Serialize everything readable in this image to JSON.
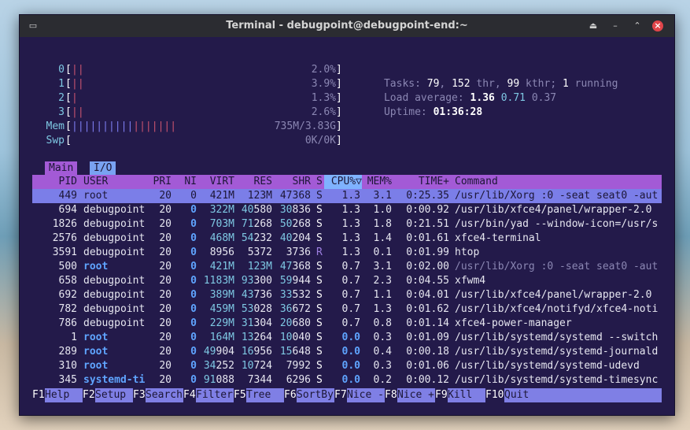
{
  "window": {
    "title": "Terminal - debugpoint@debugpoint-end:~"
  },
  "meters": {
    "cpu": [
      {
        "label": "0",
        "bars": "||",
        "percent": "2.0%"
      },
      {
        "label": "1",
        "bars": "||",
        "percent": "3.9%"
      },
      {
        "label": "2",
        "bars": "|",
        "percent": "1.3%"
      },
      {
        "label": "3",
        "bars": "||",
        "percent": "2.6%"
      }
    ],
    "mem": {
      "label": "Mem",
      "bars": "|||||||||||||||||",
      "value": "735M/3.83G"
    },
    "swp": {
      "label": "Swp",
      "value": "0K/0K"
    },
    "tasks_label": "Tasks:",
    "tasks": "79",
    "thr": "152",
    "thr_label": "thr,",
    "kthr": "99",
    "kthr_label": "kthr;",
    "running": "1",
    "running_label": "running",
    "load_label": "Load average:",
    "load1": "1.36",
    "load5": "0.71",
    "load15": "0.37",
    "uptime_label": "Uptime:",
    "uptime": "01:36:28"
  },
  "tabs": [
    "Main",
    "I/O"
  ],
  "columns": [
    "PID",
    "USER",
    "PRI",
    "NI",
    "VIRT",
    "RES",
    "SHR",
    "S",
    "CPU%▽",
    "MEM%",
    "TIME+",
    "Command"
  ],
  "rows": [
    {
      "pid": "449",
      "user": "root",
      "pri": "20",
      "ni": "0",
      "virt": "421M",
      "res": "123M",
      "shr": "47368",
      "s": "S",
      "cpu": "1.3",
      "mem": "3.1",
      "time": "0:25.35",
      "cmd": "/usr/lib/Xorg :0 -seat seat0 -aut"
    },
    {
      "pid": "694",
      "user": "debugpoint",
      "pri": "20",
      "ni": "0",
      "virt": "322M",
      "res": "40580",
      "shr": "30836",
      "s": "S",
      "cpu": "1.3",
      "mem": "1.0",
      "time": "0:00.92",
      "cmd": "/usr/lib/xfce4/panel/wrapper-2.0"
    },
    {
      "pid": "1826",
      "user": "debugpoint",
      "pri": "20",
      "ni": "0",
      "virt": "703M",
      "res": "71268",
      "shr": "50268",
      "s": "S",
      "cpu": "1.3",
      "mem": "1.8",
      "time": "0:21.51",
      "cmd": "/usr/bin/yad --window-icon=/usr/s"
    },
    {
      "pid": "2576",
      "user": "debugpoint",
      "pri": "20",
      "ni": "0",
      "virt": "468M",
      "res": "54232",
      "shr": "40204",
      "s": "S",
      "cpu": "1.3",
      "mem": "1.4",
      "time": "0:01.61",
      "cmd": "xfce4-terminal"
    },
    {
      "pid": "3591",
      "user": "debugpoint",
      "pri": "20",
      "ni": "0",
      "virt": "8956",
      "res": "5372",
      "shr": "3736",
      "s": "R",
      "cpu": "1.3",
      "mem": "0.1",
      "time": "0:01.99",
      "cmd": "htop"
    },
    {
      "pid": "500",
      "user": "root",
      "pri": "20",
      "ni": "0",
      "virt": "421M",
      "res": "123M",
      "shr": "47368",
      "s": "S",
      "cpu": "0.7",
      "mem": "3.1",
      "time": "0:02.00",
      "cmd": "/usr/lib/Xorg :0 -seat seat0 -aut"
    },
    {
      "pid": "658",
      "user": "debugpoint",
      "pri": "20",
      "ni": "0",
      "virt": "1183M",
      "res": "93300",
      "shr": "59944",
      "s": "S",
      "cpu": "0.7",
      "mem": "2.3",
      "time": "0:04.55",
      "cmd": "xfwm4"
    },
    {
      "pid": "692",
      "user": "debugpoint",
      "pri": "20",
      "ni": "0",
      "virt": "389M",
      "res": "43736",
      "shr": "33532",
      "s": "S",
      "cpu": "0.7",
      "mem": "1.1",
      "time": "0:04.01",
      "cmd": "/usr/lib/xfce4/panel/wrapper-2.0"
    },
    {
      "pid": "782",
      "user": "debugpoint",
      "pri": "20",
      "ni": "0",
      "virt": "459M",
      "res": "53028",
      "shr": "36672",
      "s": "S",
      "cpu": "0.7",
      "mem": "1.3",
      "time": "0:01.62",
      "cmd": "/usr/lib/xfce4/notifyd/xfce4-noti"
    },
    {
      "pid": "786",
      "user": "debugpoint",
      "pri": "20",
      "ni": "0",
      "virt": "229M",
      "res": "31304",
      "shr": "20680",
      "s": "S",
      "cpu": "0.7",
      "mem": "0.8",
      "time": "0:01.14",
      "cmd": "xfce4-power-manager"
    },
    {
      "pid": "1",
      "user": "root",
      "pri": "20",
      "ni": "0",
      "virt": "164M",
      "res": "13264",
      "shr": "10040",
      "s": "S",
      "cpu": "0.0",
      "mem": "0.3",
      "time": "0:01.09",
      "cmd": "/usr/lib/systemd/systemd --switch"
    },
    {
      "pid": "289",
      "user": "root",
      "pri": "20",
      "ni": "0",
      "virt": "49904",
      "res": "16956",
      "shr": "15648",
      "s": "S",
      "cpu": "0.0",
      "mem": "0.4",
      "time": "0:00.18",
      "cmd": "/usr/lib/systemd/systemd-journald"
    },
    {
      "pid": "310",
      "user": "root",
      "pri": "20",
      "ni": "0",
      "virt": "34252",
      "res": "10724",
      "shr": "7992",
      "s": "S",
      "cpu": "0.0",
      "mem": "0.3",
      "time": "0:01.06",
      "cmd": "/usr/lib/systemd/systemd-udevd"
    },
    {
      "pid": "345",
      "user": "systemd-ti",
      "pri": "20",
      "ni": "0",
      "virt": "91088",
      "res": "7344",
      "shr": "6296",
      "s": "S",
      "cpu": "0.0",
      "mem": "0.2",
      "time": "0:00.12",
      "cmd": "/usr/lib/systemd/systemd-timesync"
    }
  ],
  "fkeys": [
    {
      "key": "F1",
      "label": "Help  "
    },
    {
      "key": "F2",
      "label": "Setup "
    },
    {
      "key": "F3",
      "label": "Search"
    },
    {
      "key": "F4",
      "label": "Filter"
    },
    {
      "key": "F5",
      "label": "Tree  "
    },
    {
      "key": "F6",
      "label": "SortBy"
    },
    {
      "key": "F7",
      "label": "Nice -"
    },
    {
      "key": "F8",
      "label": "Nice +"
    },
    {
      "key": "F9",
      "label": "Kill  "
    },
    {
      "key": "F10",
      "label": "Quit  "
    }
  ]
}
